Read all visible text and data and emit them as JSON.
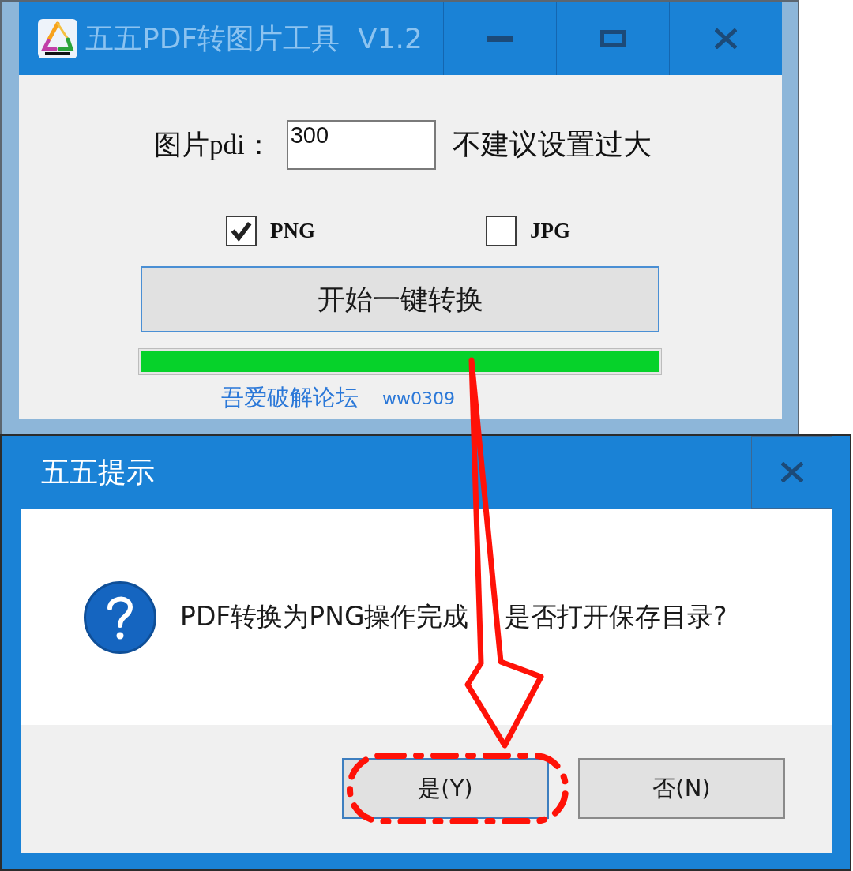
{
  "main_window": {
    "title": "五五PDF转图片工具  V1.2",
    "active": false,
    "dpi_field": {
      "label": "图片pdi：",
      "value": "300",
      "hint": "不建议设置过大"
    },
    "formats": [
      {
        "label": "PNG",
        "checked": true
      },
      {
        "label": "JPG",
        "checked": false
      }
    ],
    "convert_button": {
      "label": "开始一键转换",
      "focused": true
    },
    "progress": {
      "level": 1
    },
    "footer": {
      "forum": "吾爱破解论坛",
      "author": "ww0309"
    }
  },
  "dialog": {
    "title": "五五提示",
    "active": true,
    "message": "PDF转换为PNG操作完成 是否打开保存目录?",
    "buttons": [
      {
        "label": "是(Y)",
        "focused": true
      },
      {
        "label": "否(N)",
        "focused": false
      }
    ]
  }
}
